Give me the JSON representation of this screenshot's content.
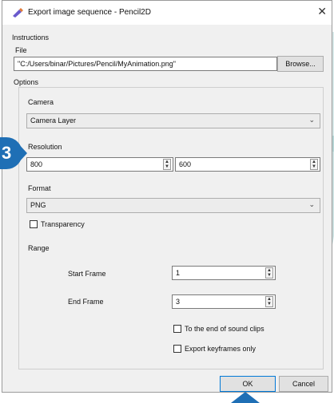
{
  "window": {
    "title": "Export image sequence - Pencil2D",
    "close_glyph": "✕"
  },
  "instructions_label": "Instructions",
  "file": {
    "label": "File",
    "path": "\"C:/Users/binar/Pictures/Pencil/MyAnimation.png\"",
    "browse_label": "Browse..."
  },
  "options": {
    "label": "Options",
    "camera": {
      "label": "Camera",
      "selected": "Camera Layer"
    },
    "resolution": {
      "label": "Resolution",
      "width": "800",
      "height": "600"
    },
    "format": {
      "label": "Format",
      "selected": "PNG",
      "transparency_label": "Transparency",
      "transparency_checked": false
    },
    "range": {
      "label": "Range",
      "start_label": "Start Frame",
      "start_value": "1",
      "end_label": "End Frame",
      "end_value": "3",
      "sound_clips_label": "To the end of sound clips",
      "keyframes_label": "Export keyframes only"
    }
  },
  "buttons": {
    "ok": "OK",
    "cancel": "Cancel"
  },
  "annotation": {
    "badge_text": "3",
    "accent_color": "#1f6fb5"
  },
  "icons": {
    "app": "pencil-icon",
    "dropdown": "chevron-down-icon",
    "spin": "spinner-arrows-icon"
  }
}
